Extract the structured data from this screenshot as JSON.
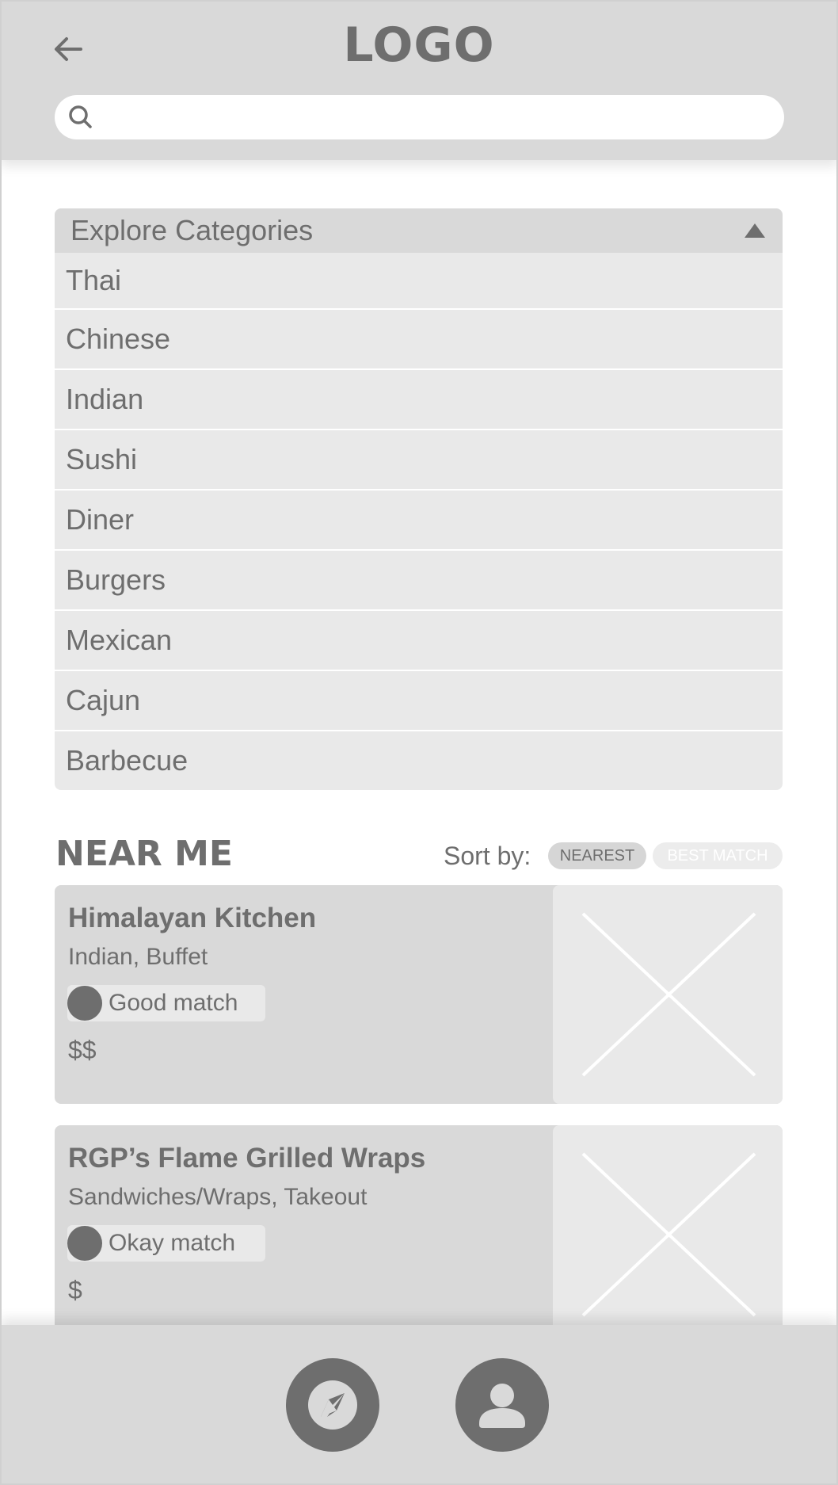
{
  "header": {
    "logo": "LOGO",
    "back_icon": "back-arrow-icon",
    "search": {
      "value": "",
      "placeholder": "",
      "icon": "search-icon"
    }
  },
  "categories": {
    "title": "Explore Categories",
    "expanded": true,
    "items": [
      "Thai",
      "Chinese",
      "Indian",
      "Sushi",
      "Diner",
      "Burgers",
      "Mexican",
      "Cajun",
      "Barbecue"
    ]
  },
  "near_me": {
    "title": "NEAR ME",
    "sort_label": "Sort by:",
    "sort_options": [
      "NEAREST",
      "BEST MATCH"
    ],
    "selected_sort": "NEAREST",
    "results": [
      {
        "name": "Himalayan Kitchen",
        "tags": "Indian, Buffet",
        "match": "Good match",
        "price": "$$"
      },
      {
        "name": "RGP’s Flame Grilled Wraps",
        "tags": "Sandwiches/Wraps, Takeout",
        "match": "Okay match",
        "price": "$"
      }
    ]
  },
  "bottom_nav": {
    "items": [
      "compass-icon",
      "user-icon"
    ]
  },
  "colors": {
    "header_bg": "#d9d9d9",
    "panel_bg": "#e9e9e9",
    "text": "#6e6e6e",
    "white": "#ffffff"
  }
}
